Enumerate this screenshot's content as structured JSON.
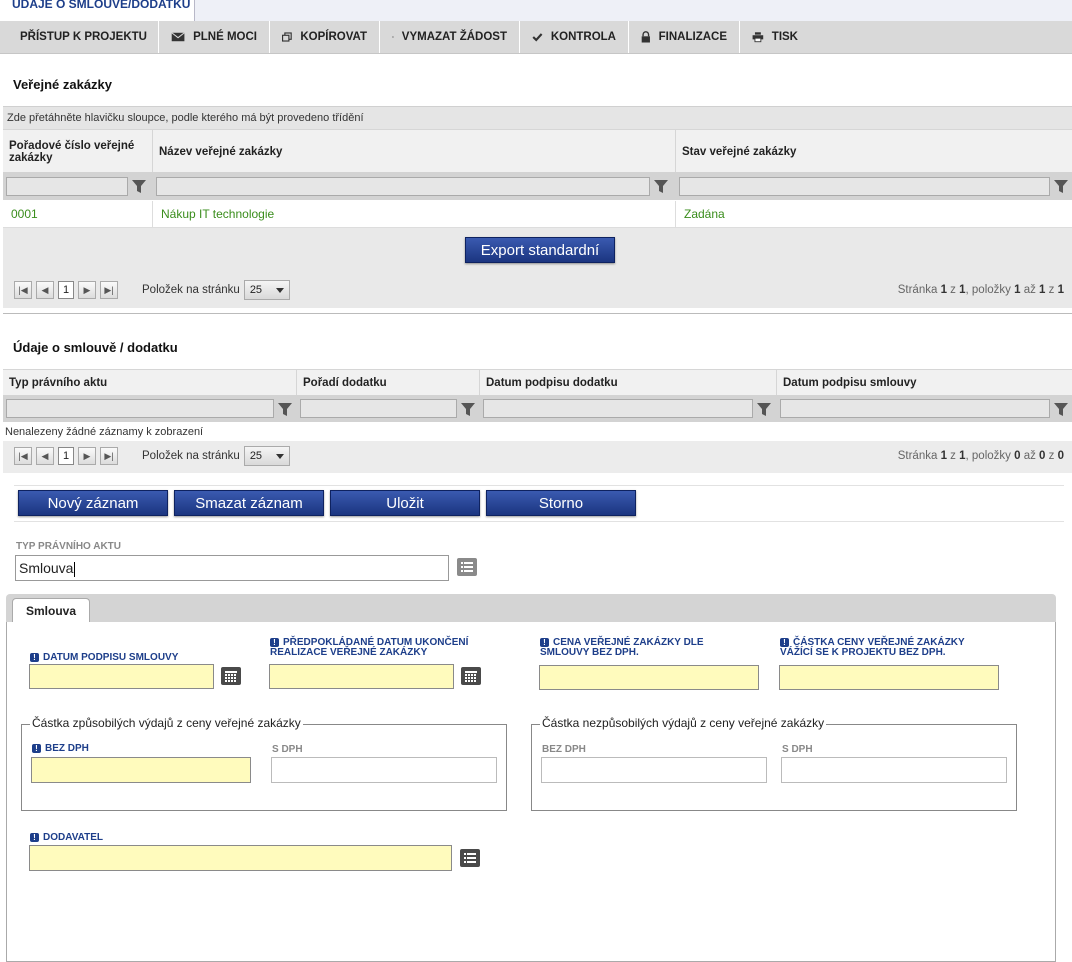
{
  "top_tab": "ÚDAJE O SMLOUVĚ/DODATKU",
  "toolbar": [
    {
      "label": "PŘÍSTUP K PROJEKTU",
      "icon": "users-icon"
    },
    {
      "label": "PLNÉ MOCI",
      "icon": "envelope-icon"
    },
    {
      "label": "KOPÍROVAT",
      "icon": "copy-icon"
    },
    {
      "label": "VYMAZAT ŽÁDOST",
      "icon": "x-icon"
    },
    {
      "label": "KONTROLA",
      "icon": "check-icon"
    },
    {
      "label": "FINALIZACE",
      "icon": "lock-icon"
    },
    {
      "label": "TISK",
      "icon": "printer-icon"
    }
  ],
  "contracts": {
    "title": "Veřejné zakázky",
    "group_hint": "Zde přetáhněte hlavičku sloupce, podle kterého má být provedeno třídění",
    "columns": [
      "Pořadové číslo veřejné zakázky",
      "Název veřejné zakázky",
      "Stav veřejné zakázky"
    ],
    "rows": [
      [
        "0001",
        "Nákup IT technologie",
        "Zadána"
      ]
    ],
    "export_label": "Export standardní",
    "page": "1",
    "page_size_label": "Položek na stránku",
    "page_size": "25",
    "page_info": {
      "p1": "Stránka ",
      "b1": "1",
      "p2": " z ",
      "b2": "1",
      "p3": ", položky ",
      "b3": "1",
      "p4": " až ",
      "b4": "1",
      "p5": " z ",
      "b5": "1"
    }
  },
  "amendment": {
    "title": "Údaje o smlouvě / dodatku",
    "columns": [
      "Typ právního aktu",
      "Pořadí dodatku",
      "Datum podpisu dodatku",
      "Datum podpisu smlouvy"
    ],
    "empty_text": "Nenalezeny žádné záznamy k zobrazení",
    "page": "1",
    "page_size_label": "Položek na stránku",
    "page_size": "25",
    "page_info": {
      "p1": "Stránka ",
      "b1": "1",
      "p2": " z ",
      "b2": "1",
      "p3": ", položky ",
      "b3": "0",
      "p4": " až ",
      "b4": "0",
      "p5": " z ",
      "b5": "0"
    }
  },
  "actions": {
    "new": "Nový záznam",
    "delete": "Smazat záznam",
    "save": "Uložit",
    "cancel": "Storno"
  },
  "form": {
    "type_label": "TYP PRÁVNÍHO AKTU",
    "type_value": "Smlouva",
    "tab": "Smlouva",
    "sign_date_label": "DATUM PODPISU SMLOUVY",
    "end_date_label": "PŘEDPOKLÁDANÉ DATUM UKONČENÍ REALIZACE VEŘEJNÉ ZAKÁZKY",
    "price_label": "CENA VEŘEJNÉ ZAKÁZKY DLE SMLOUVY BEZ DPH.",
    "project_price_label": "ČÁSTKA CENY VEŘEJNÉ ZAKÁZKY VÁŽÍCÍ SE K PROJEKTU BEZ DPH.",
    "eligible_legend": "Částka způsobilých výdajů z ceny veřejné zakázky",
    "ineligible_legend": "Částka nezpůsobilých výdajů z ceny veřejné zakázky",
    "without_vat": "BEZ DPH",
    "with_vat": "S DPH",
    "supplier_label": "DODAVATEL"
  }
}
